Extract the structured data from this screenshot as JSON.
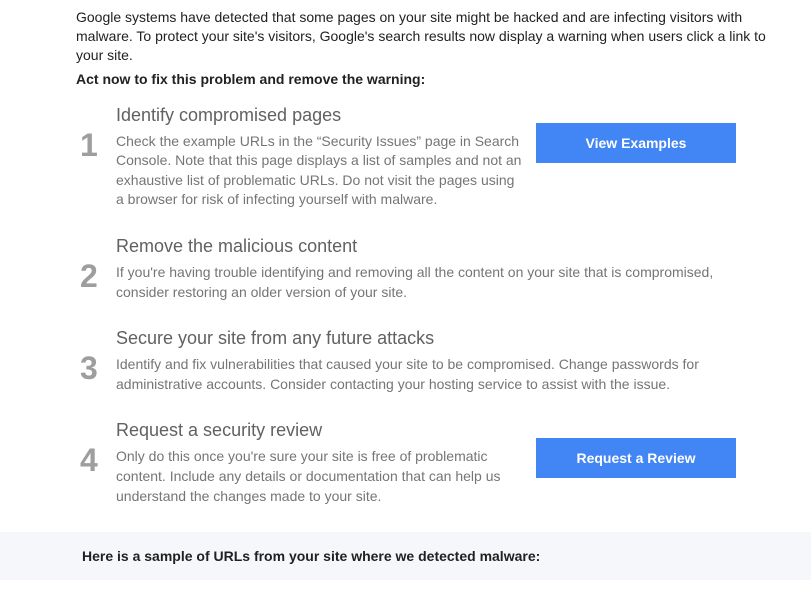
{
  "intro": "Google systems have detected that some pages on your site might be hacked and are infecting visitors with malware. To protect your site's visitors, Google's search results now display a warning when users click a link to your site.",
  "act_now": "Act now to fix this problem and remove the warning:",
  "steps": [
    {
      "num": "1",
      "title": "Identify compromised pages",
      "desc": "Check the example URLs in the “Security Issues” page in Search Console. Note that this page displays a list of samples and not an exhaustive list of problematic URLs. Do not visit the pages using a browser for risk of infecting yourself with malware.",
      "button": "View Examples"
    },
    {
      "num": "2",
      "title": "Remove the malicious content",
      "desc": "If you're having trouble identifying and removing all the content on your site that is compromised, consider restoring an older version of your site."
    },
    {
      "num": "3",
      "title": "Secure your site from any future attacks",
      "desc": "Identify and fix vulnerabilities that caused your site to be compromised. Change passwords for administrative accounts. Consider contacting your hosting service to assist with the issue."
    },
    {
      "num": "4",
      "title": "Request a security review",
      "desc": "Only do this once you're sure your site is free of problematic content. Include any details or documentation that can help us understand the changes made to your site.",
      "button": "Request a Review"
    }
  ],
  "sample_heading": "Here is a sample of URLs from your site where we detected malware:"
}
